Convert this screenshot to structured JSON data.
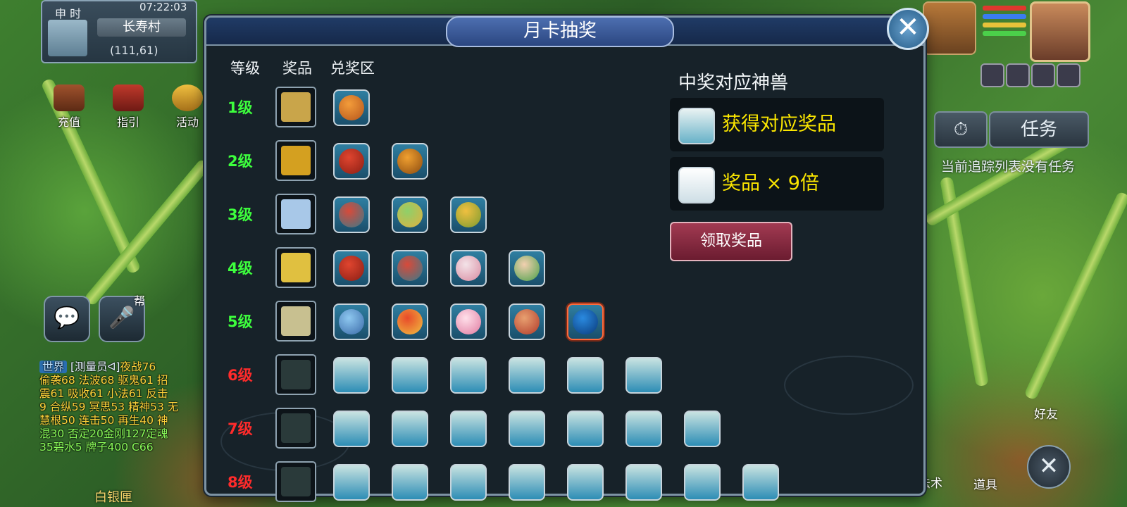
{
  "hud": {
    "time_label": "申 时",
    "clock": "07:22:03",
    "city": "长寿村",
    "coords": "(111,61)"
  },
  "left_buttons": [
    {
      "label": "充值"
    },
    {
      "label": "指引"
    },
    {
      "label": "活动"
    }
  ],
  "voice_tag": "帮",
  "chat": {
    "channel": "世界",
    "speaker": "[测量员ᐊ]",
    "lines": [
      "夜战76",
      "偷袭68 法波68 驱鬼61 招",
      "震61 吸收61 小法61 反击",
      "9 合纵59 冥思53 精神53 无",
      "慧根50 连击50 再生40 神",
      "混30 否定20金刚127定魂",
      "35碧水5 牌子400 C66"
    ],
    "bottom_label": "白银匣"
  },
  "right_hud": {
    "task_tab": "任务",
    "task_note": "当前追踪列表没有任务",
    "friend": "好友",
    "skill": "法术",
    "items": "道具",
    "colors": {
      "hp": "#e0382e",
      "mp": "#3b7cf0",
      "sp": "#e8c23a",
      "exp": "#4bd04a"
    }
  },
  "modal": {
    "title": "月卡抽奖",
    "columns": {
      "level": "等级",
      "prize": "奖品",
      "redeem": "兑奖区"
    },
    "rows": [
      {
        "label": "1级",
        "color": "#3dff3d",
        "pets": [
          "deer"
        ],
        "empty": 0
      },
      {
        "label": "2级",
        "color": "#3dff3d",
        "pets": [
          "lion",
          "tiger"
        ],
        "empty": 0
      },
      {
        "label": "3级",
        "color": "#3dff3d",
        "pets": [
          "bird",
          "rainbow",
          "owl"
        ],
        "empty": 0
      },
      {
        "label": "4级",
        "color": "#3dff3d",
        "pets": [
          "lion",
          "bird",
          "fox",
          "sprout"
        ],
        "empty": 0
      },
      {
        "label": "5级",
        "color": "#3dff3d",
        "pets": [
          "dragon",
          "phoenix",
          "rabbit",
          "lion2",
          "dolphin"
        ],
        "empty": 0,
        "selected": 4
      },
      {
        "label": "6级",
        "color": "#ff2b2b",
        "pets": [],
        "empty": 6
      },
      {
        "label": "7级",
        "color": "#ff2b2b",
        "pets": [],
        "empty": 7
      },
      {
        "label": "8级",
        "color": "#ff2b2b",
        "pets": [],
        "empty": 8
      }
    ],
    "side": {
      "title": "中奖对应神兽",
      "box1": "获得对应奖品",
      "box2": "奖品 × 9倍",
      "claim_button": "领取奖品"
    }
  }
}
